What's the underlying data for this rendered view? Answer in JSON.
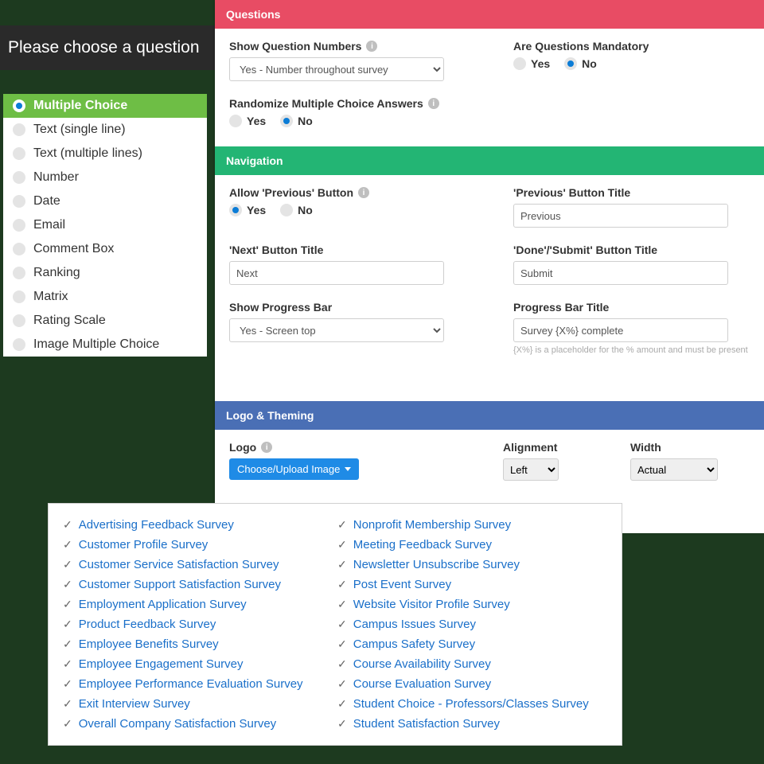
{
  "header": {
    "title": "Please choose a question"
  },
  "questionTypes": [
    {
      "label": "Multiple Choice",
      "selected": true
    },
    {
      "label": "Text (single line)",
      "selected": false
    },
    {
      "label": "Text (multiple lines)",
      "selected": false
    },
    {
      "label": "Number",
      "selected": false
    },
    {
      "label": "Date",
      "selected": false
    },
    {
      "label": "Email",
      "selected": false
    },
    {
      "label": "Comment Box",
      "selected": false
    },
    {
      "label": "Ranking",
      "selected": false
    },
    {
      "label": "Matrix",
      "selected": false
    },
    {
      "label": "Rating Scale",
      "selected": false
    },
    {
      "label": "Image Multiple Choice",
      "selected": false
    }
  ],
  "sections": {
    "questions": {
      "title": "Questions",
      "showNumbers": {
        "label": "Show Question Numbers",
        "value": "Yes - Number throughout survey"
      },
      "mandatory": {
        "label": "Are Questions Mandatory",
        "yes": "Yes",
        "no": "No",
        "value": "No"
      },
      "randomize": {
        "label": "Randomize Multiple Choice Answers",
        "yes": "Yes",
        "no": "No",
        "value": "No"
      }
    },
    "nav": {
      "title": "Navigation",
      "allowPrev": {
        "label": "Allow 'Previous' Button",
        "yes": "Yes",
        "no": "No",
        "value": "Yes"
      },
      "prevTitle": {
        "label": "'Previous' Button Title",
        "value": "Previous"
      },
      "nextTitle": {
        "label": "'Next' Button Title",
        "value": "Next"
      },
      "doneTitle": {
        "label": "'Done'/'Submit' Button Title",
        "value": "Submit"
      },
      "progressBar": {
        "label": "Show Progress Bar",
        "value": "Yes - Screen top"
      },
      "progressTitle": {
        "label": "Progress Bar Title",
        "value": "Survey {X%} complete",
        "hint": "{X%} is a placeholder for the % amount and must be present"
      }
    },
    "logo": {
      "title": "Logo & Theming",
      "logoLabel": "Logo",
      "chooseBtn": "Choose/Upload Image",
      "alignmentLabel": "Alignment",
      "alignmentValue": "Left",
      "widthLabel": "Width",
      "widthValue": "Actual"
    }
  },
  "templates": {
    "left": [
      "Advertising Feedback Survey",
      "Customer Profile Survey",
      "Customer Service Satisfaction Survey",
      "Customer Support Satisfaction Survey",
      "Employment Application Survey",
      "Product Feedback Survey",
      "Employee Benefits Survey",
      "Employee Engagement Survey",
      "Employee Performance Evaluation Survey",
      "Exit Interview Survey",
      "Overall Company Satisfaction Survey"
    ],
    "right": [
      "Nonprofit Membership Survey",
      "Meeting Feedback Survey",
      "Newsletter Unsubscribe Survey",
      "Post Event Survey",
      "Website Visitor Profile Survey",
      "Campus Issues Survey",
      "Campus Safety Survey",
      "Course Availability Survey",
      "Course Evaluation Survey",
      "Student Choice - Professors/Classes Survey",
      "Student Satisfaction Survey"
    ]
  }
}
